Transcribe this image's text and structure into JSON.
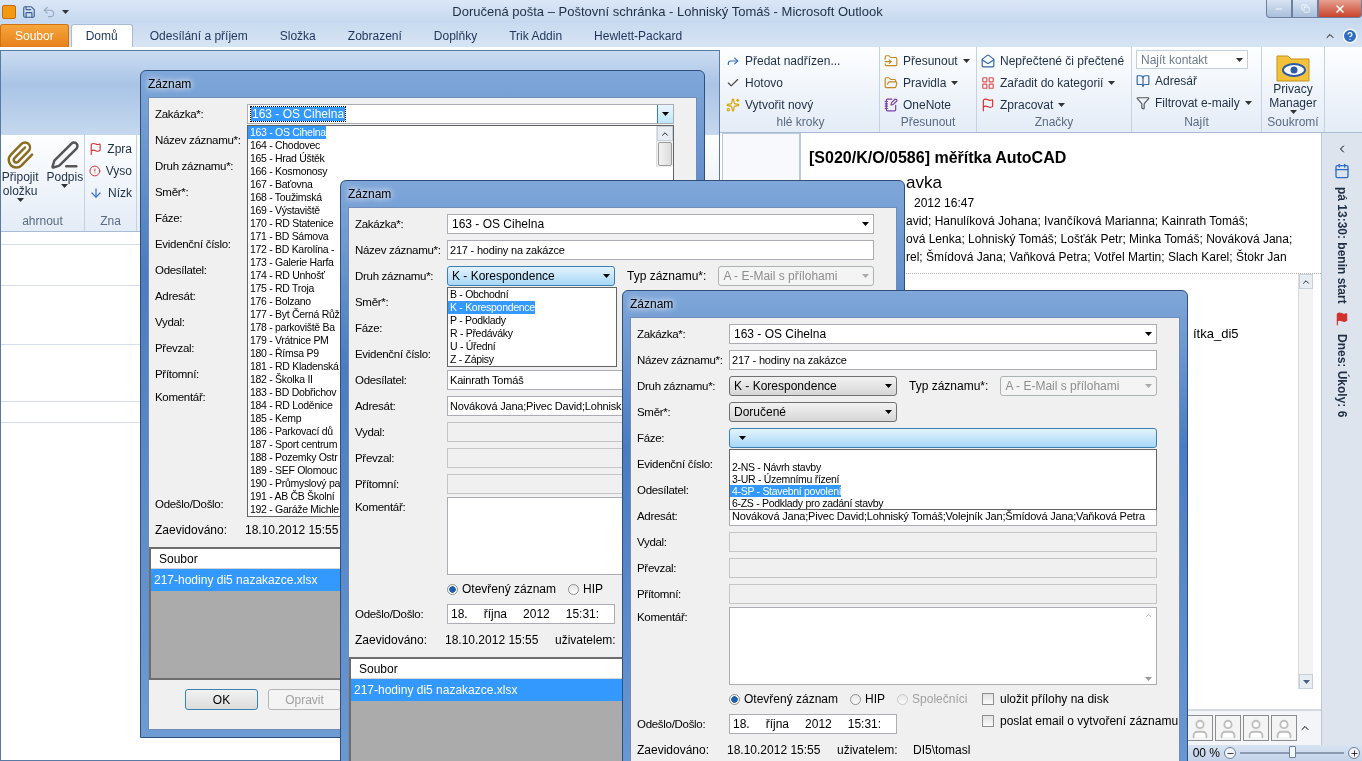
{
  "window": {
    "title": "Doručená pošta – Poštovní schránka - Lohniský Tomáš  -  Microsoft Outlook"
  },
  "ribbon_tabs": [
    {
      "label": "Soubor",
      "kind": "file",
      "selected": false
    },
    {
      "label": "Domů",
      "kind": "tab",
      "selected": true
    },
    {
      "label": "Odesílání a příjem",
      "kind": "tab",
      "selected": false
    },
    {
      "label": "Složka",
      "kind": "tab",
      "selected": false
    },
    {
      "label": "Zobrazení",
      "kind": "tab",
      "selected": false
    },
    {
      "label": "Doplňky",
      "kind": "tab",
      "selected": false
    },
    {
      "label": "Trik Addin",
      "kind": "tab",
      "selected": false
    },
    {
      "label": "Hewlett-Packard",
      "kind": "tab",
      "selected": false
    }
  ],
  "ribbon_groups": [
    {
      "label": "hlé kroky",
      "items": [
        {
          "kind": "small",
          "lines": [
            "Předat nadřízen..."
          ],
          "menu": false
        },
        {
          "kind": "small",
          "lines": [
            "Hotovo"
          ],
          "menu": false
        },
        {
          "kind": "small",
          "lines": [
            "Vytvořit nový"
          ],
          "menu": false
        }
      ]
    },
    {
      "label": "Přesunout",
      "items": [
        {
          "kind": "small",
          "lines": [
            "Přesunout"
          ],
          "menu": true
        },
        {
          "kind": "small",
          "lines": [
            "Pravidla"
          ],
          "menu": true
        },
        {
          "kind": "small",
          "lines": [
            "OneNote"
          ],
          "menu": false
        }
      ]
    },
    {
      "label": "Značky",
      "items": [
        {
          "kind": "small",
          "lines": [
            "Nepřečtené či přečtené"
          ],
          "menu": false
        },
        {
          "kind": "small",
          "lines": [
            "Zařadit do kategorií"
          ],
          "menu": true
        },
        {
          "kind": "small",
          "lines": [
            "Zpracovat"
          ],
          "menu": true
        }
      ]
    },
    {
      "label": "Najít",
      "items": [
        {
          "kind": "search",
          "lines": [
            "Najít kontakt"
          ],
          "menu": true
        },
        {
          "kind": "small",
          "lines": [
            "Adresář"
          ],
          "menu": false
        },
        {
          "kind": "small",
          "lines": [
            "Filtrovat e-maily"
          ],
          "menu": true
        }
      ]
    },
    {
      "label": "Soukromí",
      "items": [
        {
          "kind": "large",
          "lines": [
            "Privacy",
            "Manager"
          ],
          "menu": true
        }
      ]
    }
  ],
  "compose_window": {
    "ribbon_groups": [
      {
        "label": "ahrnout",
        "items": [
          {
            "kind": "large",
            "lines": [
              "Připojit",
              "oložku"
            ],
            "menu": true
          },
          {
            "kind": "large",
            "lines": [
              "Podpis"
            ],
            "menu": true
          }
        ]
      },
      {
        "label": "Zna",
        "items": [
          {
            "kind": "small",
            "lines": [
              "Zpra"
            ]
          },
          {
            "kind": "small",
            "lines": [
              "Vyso"
            ]
          },
          {
            "kind": "small",
            "lines": [
              "Nízk"
            ]
          }
        ]
      }
    ]
  },
  "message": {
    "subject": "[S020/K/O/0586] měřítka AutoCAD",
    "sender": "avka",
    "date": "2012 16:47",
    "recipients": [
      "avid; Hanulíková Johana; Ivančíková Marianna; Kainrath Tomáš;",
      "ová Lenka; Lohniský Tomáš; Lošťák Petr; Minka Tomáš; Nováková Jana;",
      "rel; Šmídová Jana; Vaňková Petra; Votřel Martin; Slach Karel; Štokr Jan"
    ],
    "body": "ítka_di5"
  },
  "todo_bar": {
    "appointment": "pá 13:30: benin start",
    "tasks": "Dnes: Úkoly: 6"
  },
  "status_bar": {
    "zoom": "00 %",
    "zoom_slider": {
      "level": 0.5
    }
  },
  "dialogs": [
    {
      "title": "Záznam",
      "fields": [
        {
          "label": "Zakázka*:",
          "kind": "combo",
          "value": "163 - OS Cihelna",
          "focused": true,
          "options": [
            {
              "label": "163 - OS Cihelna",
              "selected": true
            },
            {
              "label": "164 - Chodovec",
              "selected": false
            },
            {
              "label": "165 - Hrad Úštěk",
              "selected": false
            },
            {
              "label": "166 - Kosmonosy",
              "selected": false
            },
            {
              "label": "167 - Baťovna",
              "selected": false
            },
            {
              "label": "168 - Toužimská",
              "selected": false
            },
            {
              "label": "169 - Výstaviště",
              "selected": false
            },
            {
              "label": "170 - RD Statenice",
              "selected": false
            },
            {
              "label": "171 - BD Sámova",
              "selected": false
            },
            {
              "label": "172 - BD Karolína -",
              "selected": false
            },
            {
              "label": "173 - Galerie Harfa",
              "selected": false
            },
            {
              "label": "174 - RD Unhošť",
              "selected": false
            },
            {
              "label": "175 - RD Troja",
              "selected": false
            },
            {
              "label": "176 - Bolzano",
              "selected": false
            },
            {
              "label": "177 - Byt Černá Růž",
              "selected": false
            },
            {
              "label": "178 - parkoviště Ba",
              "selected": false
            },
            {
              "label": "179 - Vrátnice PM",
              "selected": false
            },
            {
              "label": "180 - Římsa P9",
              "selected": false
            },
            {
              "label": "181 - RD Kladenská",
              "selected": false
            },
            {
              "label": "182 - Školka II",
              "selected": false
            },
            {
              "label": "183 - BD Dobřichov",
              "selected": false
            },
            {
              "label": "184 - RD Loděnice",
              "selected": false
            },
            {
              "label": "185 - Kemp",
              "selected": false
            },
            {
              "label": "186 - Parkovací dů",
              "selected": false
            },
            {
              "label": "187 - Sport centrum",
              "selected": false
            },
            {
              "label": "188 - Pozemky Ostr",
              "selected": false
            },
            {
              "label": "189 - SEF Olomouc",
              "selected": false
            },
            {
              "label": "190 - Průmyslový pa",
              "selected": false
            },
            {
              "label": "191 - AB ČB Školní",
              "selected": false
            },
            {
              "label": "192 - Garáže Michle",
              "selected": false
            }
          ]
        },
        {
          "label": "Název záznamu*:",
          "kind": "label"
        },
        {
          "label": "Druh záznamu*:",
          "kind": "label"
        },
        {
          "label": "Směr*:",
          "kind": "label"
        },
        {
          "label": "Fáze:",
          "kind": "label"
        },
        {
          "label": "Evidenční číslo:",
          "kind": "label"
        },
        {
          "label": "Odesílatel:",
          "kind": "label"
        },
        {
          "label": "Adresát:",
          "kind": "label"
        },
        {
          "label": "Vydal:",
          "kind": "label"
        },
        {
          "label": "Převzal:",
          "kind": "label"
        },
        {
          "label": "Přítomní:",
          "kind": "label"
        },
        {
          "label": "Komentář:",
          "kind": "memo-label"
        }
      ],
      "date_field": {
        "label": "Odešlo/Došlo:"
      },
      "registered": {
        "label": "Zaevidováno:",
        "value": "18.10.2012 15:55"
      },
      "files": {
        "header": "Soubor",
        "items": [
          {
            "name": "217-hodiny di5 nazakazce.xlsx",
            "selected": true
          }
        ]
      },
      "buttons": [
        {
          "label": "OK",
          "disabled": false
        },
        {
          "label": "Opravit",
          "disabled": true
        }
      ]
    },
    {
      "title": "Záznam",
      "fields": [
        {
          "label": "Zakázka*:",
          "kind": "combo",
          "value": "163 - OS Cihelna",
          "focused": false
        },
        {
          "label": "Název záznamu*:",
          "kind": "text",
          "value": "217 - hodiny na zakázce"
        },
        {
          "label": "Druh záznamu*:",
          "kind": "dropdown",
          "value": "K - Korespondence",
          "focused": true,
          "options": [
            {
              "label": "B - Obchodní",
              "selected": false
            },
            {
              "label": "K - Korespondence",
              "selected": true
            },
            {
              "label": "P - Podklady",
              "selected": false
            },
            {
              "label": "R - Předáváky",
              "selected": false
            },
            {
              "label": "U - Úřední",
              "selected": false
            },
            {
              "label": "Z - Zápisy",
              "selected": false
            }
          ],
          "extra": {
            "label": "Typ záznamu*:",
            "value": "A - E-Mail s přílohami",
            "disabled": true
          }
        },
        {
          "label": "Směr*:",
          "kind": "label"
        },
        {
          "label": "Fáze:",
          "kind": "label"
        },
        {
          "label": "Evidenční číslo:",
          "kind": "label"
        },
        {
          "label": "Odesílatel:",
          "kind": "text",
          "value": "Kainrath Tomáš"
        },
        {
          "label": "Adresát:",
          "kind": "text",
          "value": "Nováková Jana;Pivec David;Lohnisk"
        },
        {
          "label": "Vydal:",
          "kind": "disabled"
        },
        {
          "label": "Převzal:",
          "kind": "disabled"
        },
        {
          "label": "Přítomní:",
          "kind": "disabled"
        },
        {
          "label": "Komentář:",
          "kind": "memo"
        }
      ],
      "radios": [
        {
          "label": "Otevřený záznam",
          "selected": true,
          "disabled": false
        },
        {
          "label": "HIP",
          "selected": false,
          "disabled": false
        }
      ],
      "date_field": {
        "label": "Odešlo/Došlo:",
        "parts": [
          "18.",
          "října",
          "2012",
          "15:31:"
        ]
      },
      "registered": {
        "label": "Zaevidováno:",
        "value": "18.10.2012 15:55",
        "user_label": "uživatelem:"
      },
      "files": {
        "header": "Soubor",
        "items": [
          {
            "name": "217-hodiny di5 nazakazce.xlsx",
            "selected": true
          }
        ]
      }
    },
    {
      "title": "Záznam",
      "fields": [
        {
          "label": "Zakázka*:",
          "kind": "combo",
          "value": "163 - OS Cihelna",
          "focused": false
        },
        {
          "label": "Název záznamu*:",
          "kind": "text",
          "value": "217 - hodiny na zakázce"
        },
        {
          "label": "Druh záznamu*:",
          "kind": "dropdown",
          "value": "K - Korespondence",
          "focused": false,
          "extra": {
            "label": "Typ záznamu*:",
            "value": "A - E-Mail s přílohami",
            "disabled": true
          }
        },
        {
          "label": "Směr*:",
          "kind": "dropdown",
          "value": "Doručené",
          "focused": false
        },
        {
          "label": "Fáze:",
          "kind": "wide-dropdown",
          "focused": true,
          "options": [
            {
              "kind": "empty",
              "selected": false
            },
            {
              "kind": "item",
              "label": "2-NS - Návrh stavby",
              "selected": false
            },
            {
              "kind": "item",
              "label": "3-UR - Územnímu řízení",
              "selected": false
            },
            {
              "kind": "item",
              "label": "4-SP - Stavební povolení",
              "selected": true
            },
            {
              "kind": "item",
              "label": "6-ZS - Podklady pro zadání stavby",
              "selected": false
            }
          ]
        },
        {
          "label": "Evidenční číslo:",
          "kind": "label"
        },
        {
          "label": "Odesílatel:",
          "kind": "label"
        },
        {
          "label": "Adresát:",
          "kind": "text",
          "value": "Nováková Jana;Pivec David;Lohniský Tomáš;Volejník Jan;Šmídová Jana;Vaňková Petra"
        },
        {
          "label": "Vydal:",
          "kind": "disabled"
        },
        {
          "label": "Převzal:",
          "kind": "disabled"
        },
        {
          "label": "Přítomní:",
          "kind": "disabled"
        },
        {
          "label": "Komentář:",
          "kind": "memo"
        }
      ],
      "radios": [
        {
          "label": "Otevřený záznam",
          "selected": true,
          "disabled": false
        },
        {
          "label": "HIP",
          "selected": false,
          "disabled": false
        },
        {
          "label": "Společníci",
          "selected": false,
          "disabled": true
        }
      ],
      "checks": [
        {
          "label": "uložit přílohy na disk",
          "checked": false
        },
        {
          "label": "poslat email o vytvoření záznamu",
          "checked": false
        }
      ],
      "date_field": {
        "label": "Odešlo/Došlo:",
        "parts": [
          "18.",
          "října",
          "2012",
          "15:31:"
        ]
      },
      "registered": {
        "label": "Zaevidováno:",
        "value": "18.10.2012 15:55",
        "user_label": "uživatelem:",
        "user": "DI5\\tomasl"
      }
    }
  ]
}
